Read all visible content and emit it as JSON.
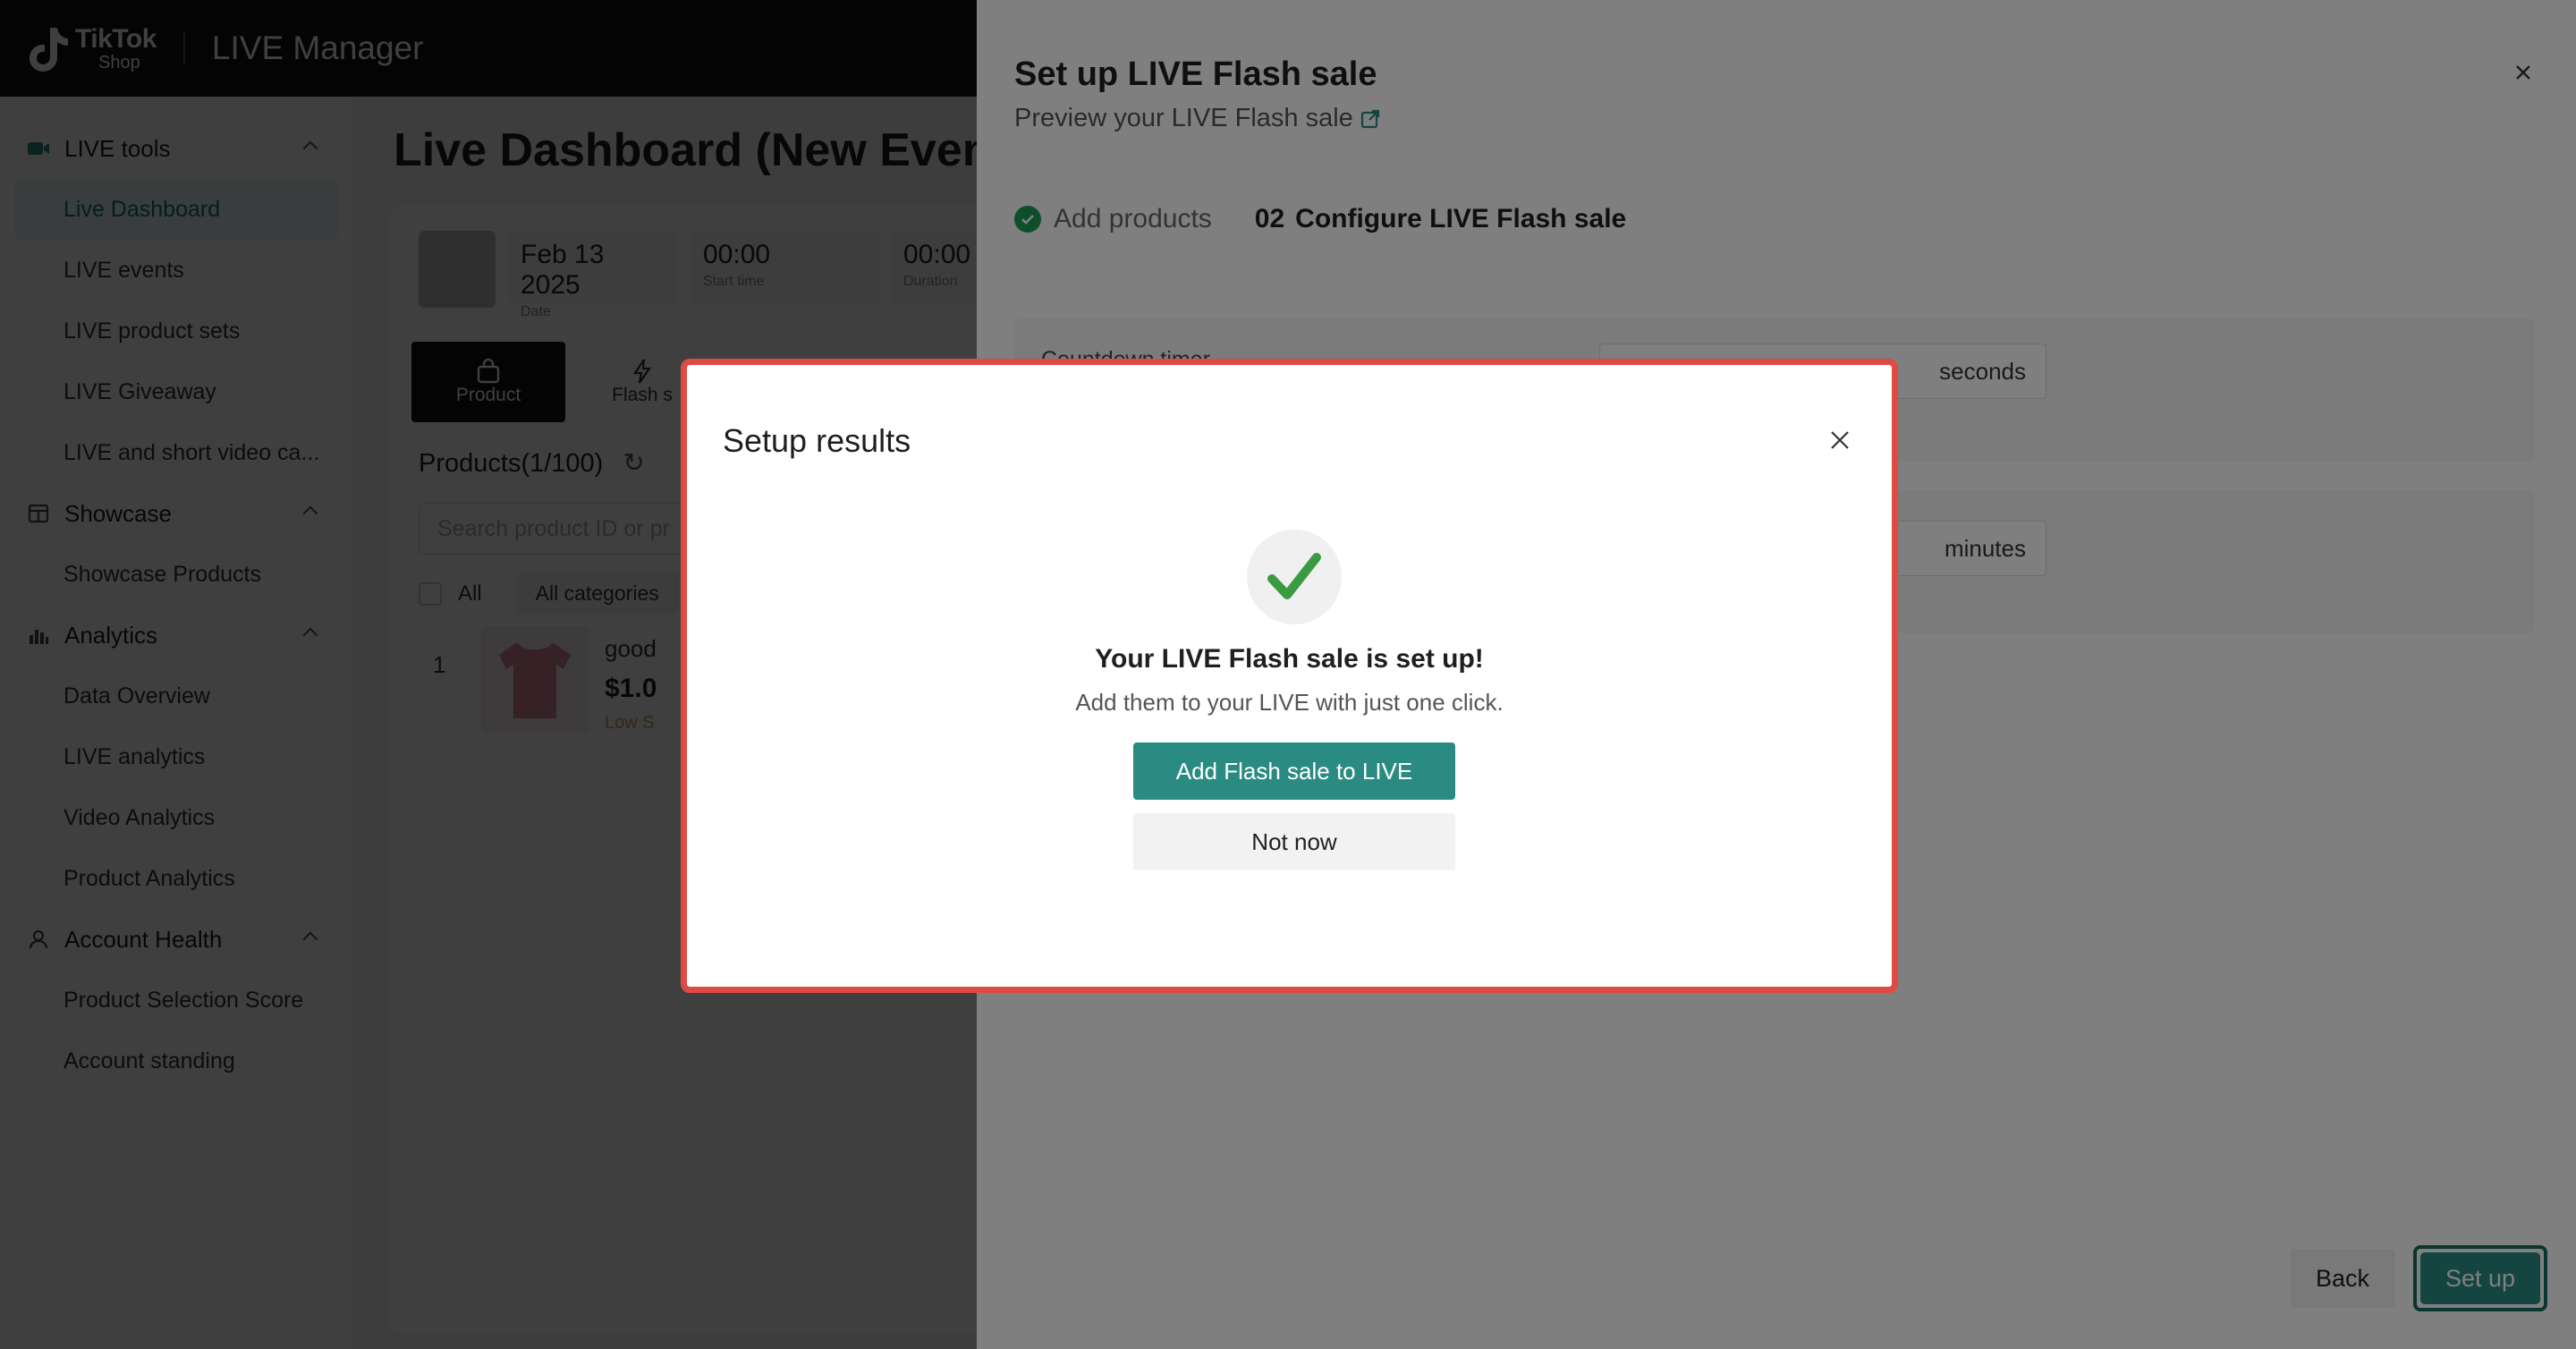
{
  "header": {
    "logo_line1": "TikTok",
    "logo_line2": "Shop",
    "app_title": "LIVE Manager"
  },
  "sidebar": {
    "groups": [
      {
        "label": "LIVE tools",
        "icon": "live-camera-icon",
        "items": [
          "Live Dashboard",
          "LIVE events",
          "LIVE product sets",
          "LIVE Giveaway",
          "LIVE and short video ca..."
        ]
      },
      {
        "label": "Showcase",
        "icon": "showcase-icon",
        "items": [
          "Showcase Products"
        ]
      },
      {
        "label": "Analytics",
        "icon": "analytics-chart-icon",
        "items": [
          "Data Overview",
          "LIVE analytics",
          "Video Analytics",
          "Product Analytics"
        ]
      },
      {
        "label": "Account Health",
        "icon": "user-icon",
        "items": [
          "Product Selection Score",
          "Account standing"
        ]
      }
    ],
    "active_item": "Live Dashboard"
  },
  "dashboard": {
    "title": "Live Dashboard (New Event",
    "date_value": "Feb 13 2025",
    "date_label": "Date",
    "start_value": "00:00",
    "start_label": "Start time",
    "end_value": "00:00",
    "end_label": "Duration",
    "tabs": [
      "Product",
      "Flash s"
    ],
    "products_head": "Products(1/100)",
    "search_placeholder": "Search product ID or pr",
    "filter_all": "All",
    "filter_categories": "All categories",
    "product_index": "1",
    "product_name": "good",
    "product_price": "$1.0",
    "product_stock": "Low S"
  },
  "drawer": {
    "title": "Set up LIVE Flash sale",
    "preview_link": "Preview your LIVE Flash sale",
    "step1_label": "Add products",
    "step2_num": "02",
    "step2_label": "Configure LIVE Flash sale",
    "countdown_label": "Countdown timer",
    "countdown_unit": "seconds",
    "duration_unit": "minutes",
    "back_label": "Back",
    "setup_label": "Set up"
  },
  "modal": {
    "title": "Setup results",
    "heading": "Your LIVE Flash sale is set up!",
    "subtext": "Add them to your LIVE with just one click.",
    "primary_button": "Add Flash sale to LIVE",
    "secondary_button": "Not now"
  },
  "colors": {
    "accent": "#2a8b82",
    "highlight_border": "#e04a45",
    "success": "#3a9a3f"
  }
}
